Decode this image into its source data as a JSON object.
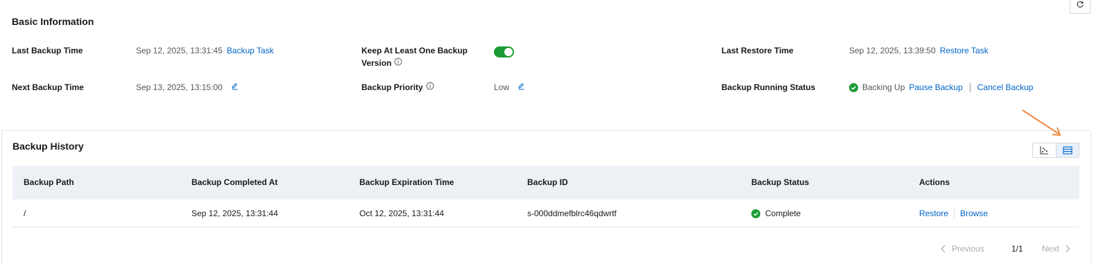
{
  "basic_info": {
    "title": "Basic Information",
    "last_backup_time": {
      "label": "Last Backup Time",
      "value": "Sep 12, 2025, 13:31:45",
      "link": "Backup Task"
    },
    "next_backup_time": {
      "label": "Next Backup Time",
      "value": "Sep 13, 2025, 13:15:00"
    },
    "keep_one_version": {
      "label_line1": "Keep At Least One Backup",
      "label_line2": "Version",
      "enabled": true
    },
    "backup_priority": {
      "label": "Backup Priority",
      "value": "Low"
    },
    "last_restore_time": {
      "label": "Last Restore Time",
      "value": "Sep 12, 2025, 13:39:50",
      "link": "Restore Task"
    },
    "running_status": {
      "label": "Backup Running Status",
      "value": "Backing Up",
      "pause": "Pause Backup",
      "cancel": "Cancel Backup"
    }
  },
  "history": {
    "title": "Backup History",
    "columns": [
      "Backup Path",
      "Backup Completed At",
      "Backup Expiration Time",
      "Backup ID",
      "Backup Status",
      "Actions"
    ],
    "rows": [
      {
        "path": "/",
        "completed_at": "Sep 12, 2025, 13:31:44",
        "expiration": "Oct 12, 2025, 13:31:44",
        "backup_id": "s-000ddmefblrc46qdwrtf",
        "status": "Complete",
        "actions": [
          "Restore",
          "Browse"
        ]
      }
    ],
    "pagination": {
      "previous": "Previous",
      "page": "1/1",
      "next": "Next"
    }
  },
  "colors": {
    "link": "#0064c8",
    "success": "#1a9c35",
    "header_bg": "#edf1f6",
    "annotation_arrow": "#f0883e"
  }
}
